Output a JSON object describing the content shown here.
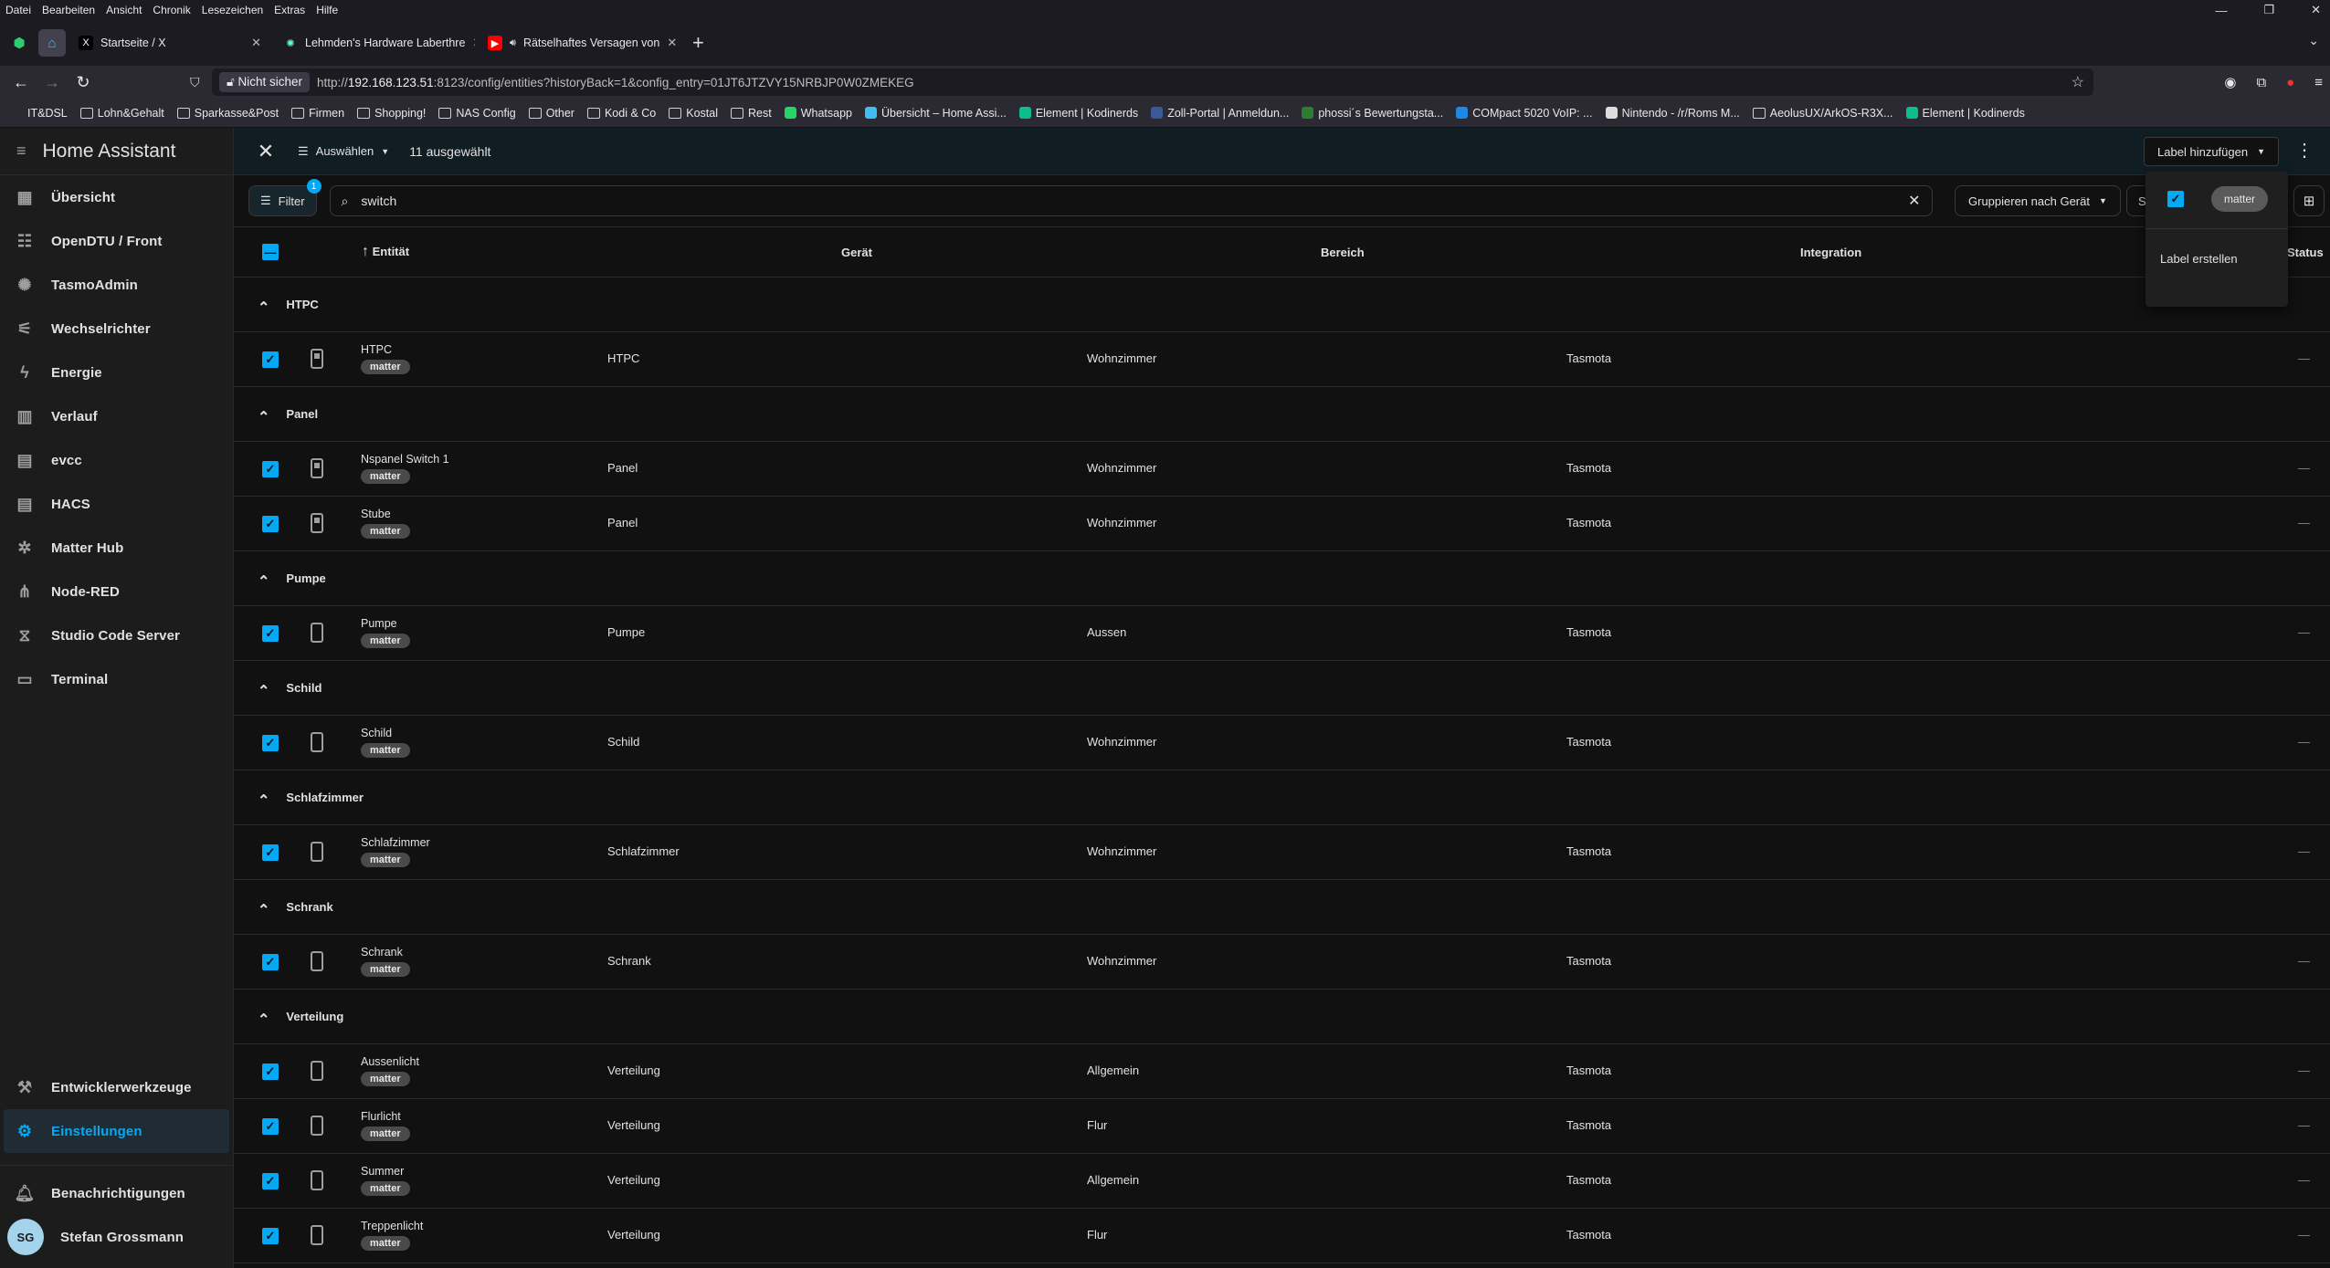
{
  "menu": [
    "Datei",
    "Bearbeiten",
    "Ansicht",
    "Chronik",
    "Lesezeichen",
    "Extras",
    "Hilfe"
  ],
  "tabs": [
    {
      "title": "Startseite / X",
      "icon": "x-icon"
    },
    {
      "title": "Lehmden's Hardware Laberthre",
      "icon": "site-icon"
    },
    {
      "title": "Rätselhaftes Versagen von",
      "icon": "youtube-icon"
    }
  ],
  "nav": {
    "not_secure": "Nicht sicher",
    "url_scheme": "http://",
    "url_host": "192.168.123.51",
    "url_rest": ":8123/config/entities?historyBack=1&config_entry=01JT6JTZVY15NRBJP0W0ZMEKEG"
  },
  "bookmarks": [
    "IT&DSL",
    "Lohn&Gehalt",
    "Sparkasse&Post",
    "Firmen",
    "Shopping!",
    "NAS Config",
    "Other",
    "Kodi & Co",
    "Kostal",
    "Rest",
    "Whatsapp",
    "Übersicht – Home Assi...",
    "Element | Kodinerds",
    "Zoll-Portal | Anmeldun...",
    "phossi´s Bewertungsta...",
    "COMpact 5020 VoIP: ...",
    "Nintendo - /r/Roms M...",
    "AeolusUX/ArkOS-R3X...",
    "Element | Kodinerds"
  ],
  "sidebar": {
    "title": "Home Assistant",
    "items": [
      {
        "label": "Übersicht",
        "icon": "dashboard-icon",
        "glyph": "▦"
      },
      {
        "label": "OpenDTU / Front",
        "icon": "grid-icon",
        "glyph": "☷"
      },
      {
        "label": "TasmoAdmin",
        "icon": "bulb-icon",
        "glyph": "✺"
      },
      {
        "label": "Wechselrichter",
        "icon": "inverter-icon",
        "glyph": "⚟"
      },
      {
        "label": "Energie",
        "icon": "lightning-icon",
        "glyph": "ϟ"
      },
      {
        "label": "Verlauf",
        "icon": "chart-icon",
        "glyph": "▥"
      },
      {
        "label": "evcc",
        "icon": "page-icon",
        "glyph": "▤"
      },
      {
        "label": "HACS",
        "icon": "hacs-icon",
        "glyph": "▤"
      },
      {
        "label": "Matter Hub",
        "icon": "matter-icon",
        "glyph": "✲"
      },
      {
        "label": "Node-RED",
        "icon": "sitemap-icon",
        "glyph": "⋔"
      },
      {
        "label": "Studio Code Server",
        "icon": "vscode-icon",
        "glyph": "⧖"
      },
      {
        "label": "Terminal",
        "icon": "terminal-icon",
        "glyph": "▭"
      }
    ],
    "devtools": "Entwicklerwerkzeuge",
    "settings": "Einstellungen",
    "notifications": "Benachrichtigungen",
    "user": "Stefan Grossmann",
    "user_initials": "SG"
  },
  "toolbar": {
    "select": "Auswählen",
    "selected": "11 ausgewählt",
    "add_label": "Label hinzufügen"
  },
  "search": {
    "filter": "Filter",
    "filter_count": "1",
    "query": "switch",
    "group_by": "Gruppieren nach Gerät",
    "sort_partial": "S"
  },
  "columns": {
    "entity": "Entität",
    "device": "Gerät",
    "area": "Bereich",
    "integration": "Integration",
    "status": "Status"
  },
  "groups": [
    {
      "name": "HTPC",
      "rows": [
        {
          "entity": "HTPC",
          "label": "matter",
          "device": "HTPC",
          "area": "Wohnzimmer",
          "integration": "Tasmota",
          "status": "—",
          "icon": "solid"
        }
      ]
    },
    {
      "name": "Panel",
      "rows": [
        {
          "entity": "Nspanel Switch 1",
          "label": "matter",
          "device": "Panel",
          "area": "Wohnzimmer",
          "integration": "Tasmota",
          "status": "—",
          "icon": "solid"
        },
        {
          "entity": "Stube",
          "label": "matter",
          "device": "Panel",
          "area": "Wohnzimmer",
          "integration": "Tasmota",
          "status": "—",
          "icon": "solid"
        }
      ]
    },
    {
      "name": "Pumpe",
      "rows": [
        {
          "entity": "Pumpe",
          "label": "matter",
          "device": "Pumpe",
          "area": "Aussen",
          "integration": "Tasmota",
          "status": "—",
          "icon": "outline"
        }
      ]
    },
    {
      "name": "Schild",
      "rows": [
        {
          "entity": "Schild",
          "label": "matter",
          "device": "Schild",
          "area": "Wohnzimmer",
          "integration": "Tasmota",
          "status": "—",
          "icon": "outline"
        }
      ]
    },
    {
      "name": "Schlafzimmer",
      "rows": [
        {
          "entity": "Schlafzimmer",
          "label": "matter",
          "device": "Schlafzimmer",
          "area": "Wohnzimmer",
          "integration": "Tasmota",
          "status": "—",
          "icon": "outline"
        }
      ]
    },
    {
      "name": "Schrank",
      "rows": [
        {
          "entity": "Schrank",
          "label": "matter",
          "device": "Schrank",
          "area": "Wohnzimmer",
          "integration": "Tasmota",
          "status": "—",
          "icon": "outline"
        }
      ]
    },
    {
      "name": "Verteilung",
      "rows": [
        {
          "entity": "Aussenlicht",
          "label": "matter",
          "device": "Verteilung",
          "area": "Allgemein",
          "integration": "Tasmota",
          "status": "—",
          "icon": "outline"
        },
        {
          "entity": "Flurlicht",
          "label": "matter",
          "device": "Verteilung",
          "area": "Flur",
          "integration": "Tasmota",
          "status": "—",
          "icon": "outline"
        },
        {
          "entity": "Summer",
          "label": "matter",
          "device": "Verteilung",
          "area": "Allgemein",
          "integration": "Tasmota",
          "status": "—",
          "icon": "outline"
        },
        {
          "entity": "Treppenlicht",
          "label": "matter",
          "device": "Verteilung",
          "area": "Flur",
          "integration": "Tasmota",
          "status": "—",
          "icon": "outline"
        }
      ]
    }
  ],
  "dropdown": {
    "label_chip": "matter",
    "create": "Label erstellen"
  },
  "colors": {
    "accent": "#03a9f4",
    "background": "#111111",
    "sidebar": "#1c1c1c"
  }
}
